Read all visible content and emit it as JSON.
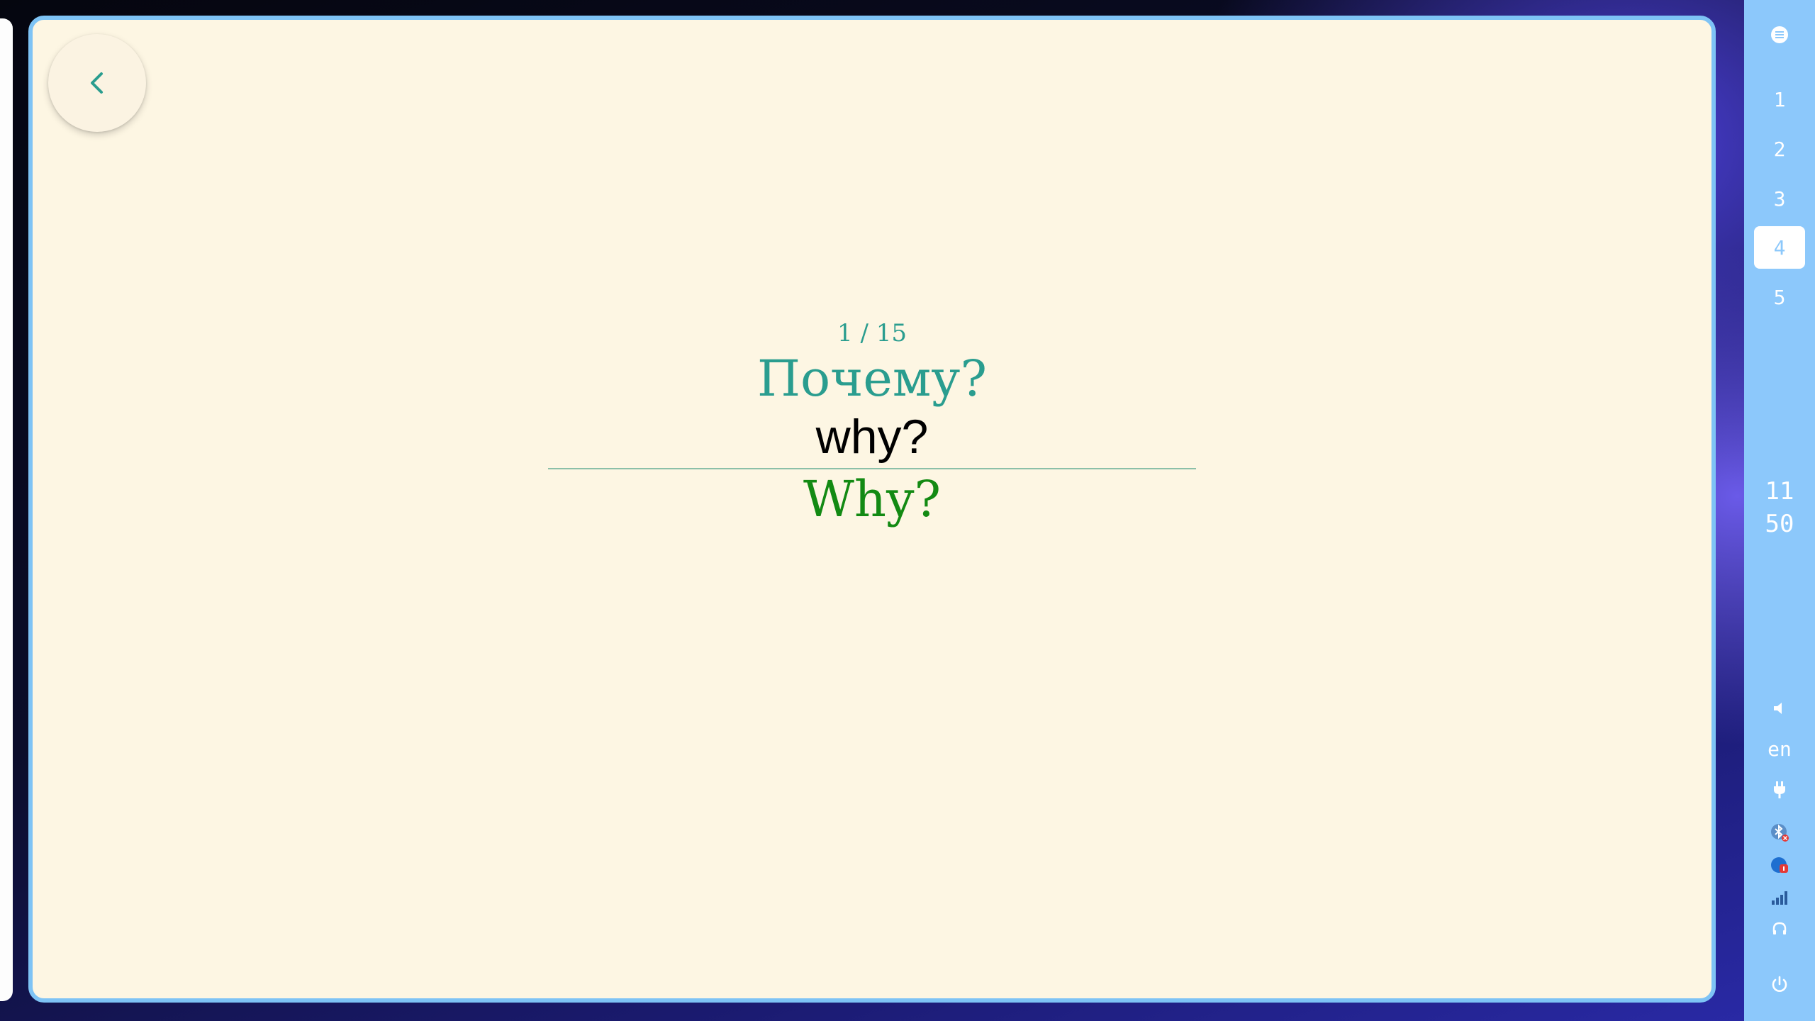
{
  "flashcard": {
    "counter": "1 / 15",
    "source_word": "Почему?",
    "typed_answer": "why?",
    "correct_answer": "Why?"
  },
  "colors": {
    "window_border": "#7ec3f5",
    "card_background": "#fdf6e3",
    "accent_teal": "#2a9d8f",
    "correct_green": "#138a13",
    "panel_background": "#8cc8fb"
  },
  "panel": {
    "workspaces": [
      {
        "label": "1",
        "active": false
      },
      {
        "label": "2",
        "active": false
      },
      {
        "label": "3",
        "active": false
      },
      {
        "label": "4",
        "active": true
      },
      {
        "label": "5",
        "active": false
      }
    ],
    "clock": {
      "hours": "11",
      "minutes": "50"
    },
    "keyboard_layout": "en",
    "tray_icons": [
      "volume-icon",
      "power-plug-icon",
      "bluetooth-off-icon",
      "network-error-icon",
      "signal-icon",
      "headphones-icon",
      "power-icon"
    ]
  }
}
